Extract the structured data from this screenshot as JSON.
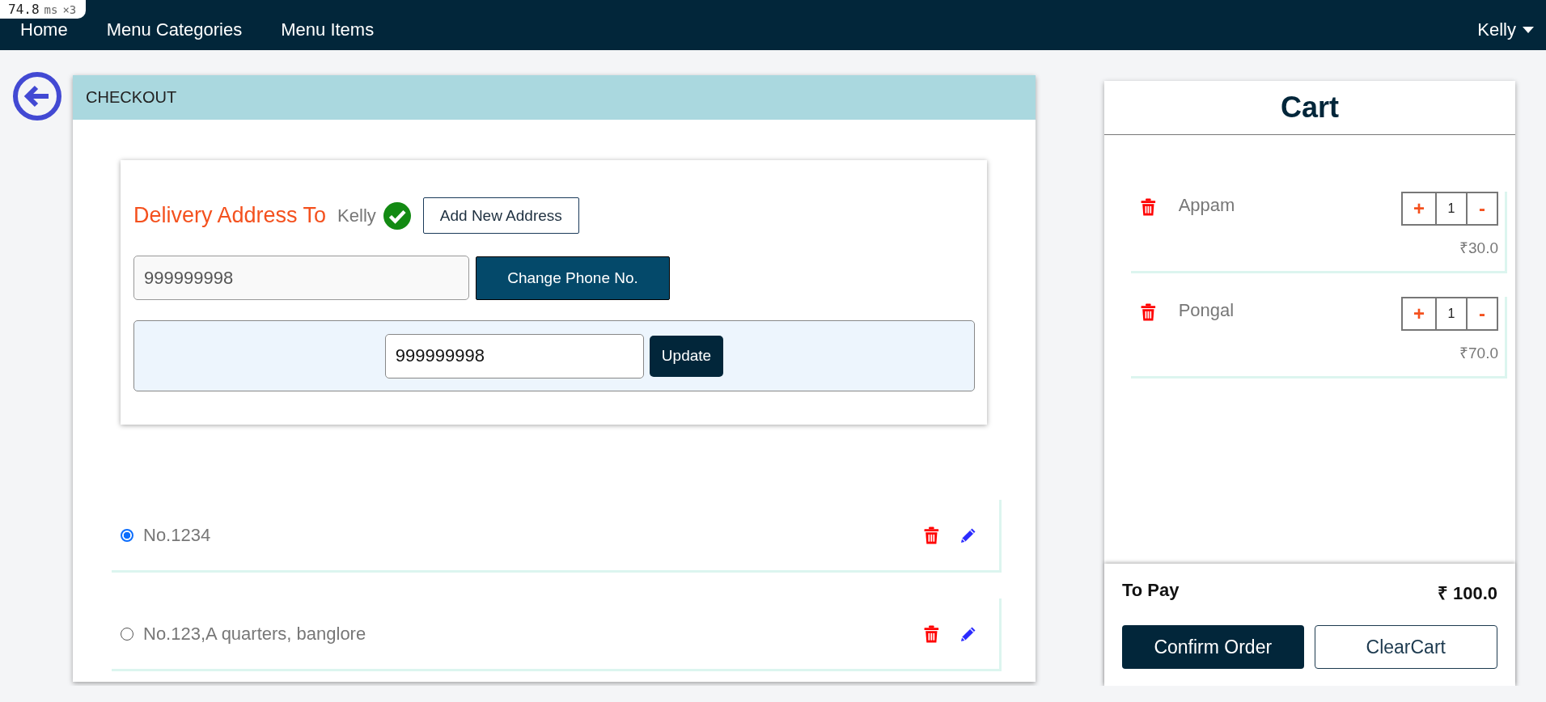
{
  "perf_badge": {
    "value": "74.8",
    "unit": "ms",
    "count": "×3"
  },
  "nav": {
    "links": [
      {
        "label": "Home"
      },
      {
        "label": "Menu Categories"
      },
      {
        "label": "Menu Items"
      }
    ],
    "user": "Kelly"
  },
  "checkout": {
    "title": "CHECKOUT",
    "delivery": {
      "heading": "Delivery Address To",
      "name": "Kelly",
      "verified": true,
      "add_button": "Add New Address",
      "phone": {
        "value": "999999998"
      },
      "change_button": "Change Phone No.",
      "update": {
        "value": "999999998",
        "button": "Update"
      }
    },
    "addresses": [
      {
        "text": "No.1234",
        "selected": true
      },
      {
        "text": "No.123,A quarters, banglore",
        "selected": false
      }
    ]
  },
  "cart": {
    "title": "Cart",
    "items": [
      {
        "name": "Appam",
        "plus": "+",
        "qty": "1",
        "minus": "-",
        "price": "₹30.0"
      },
      {
        "name": "Pongal",
        "plus": "+",
        "qty": "1",
        "minus": "-",
        "price": "₹70.0"
      }
    ],
    "to_pay_label": "To Pay",
    "total": "₹ 100.0",
    "buttons": [
      {
        "label": "Confirm Order",
        "kind": "primary"
      },
      {
        "label": "ClearCart",
        "kind": "outline"
      }
    ]
  }
}
